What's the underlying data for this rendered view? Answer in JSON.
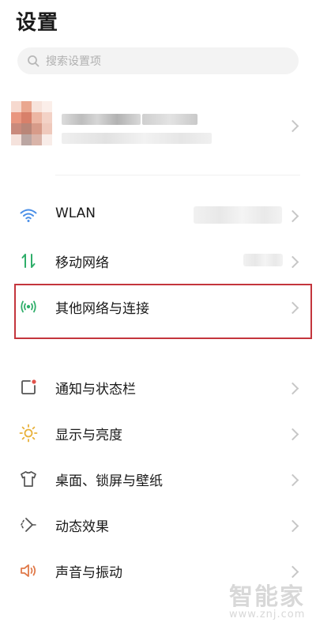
{
  "title": "设置",
  "search": {
    "placeholder": "搜索设置项",
    "icon": "search-icon"
  },
  "colors": {
    "accent_blue": "#4a8fe7",
    "accent_green": "#2fae6a",
    "accent_red": "#e2524b",
    "accent_yellow": "#e8b13a",
    "highlight_border": "#c4353d"
  },
  "sections": {
    "network": [
      {
        "label": "WLAN",
        "icon": "wifi-icon",
        "value_hidden": true
      },
      {
        "label": "移动网络",
        "icon": "mobile-data-icon",
        "value_hidden": true
      },
      {
        "label": "其他网络与连接",
        "icon": "connection-icon",
        "highlighted": true
      }
    ],
    "general": [
      {
        "label": "通知与状态栏",
        "icon": "notification-icon"
      },
      {
        "label": "显示与亮度",
        "icon": "brightness-icon"
      },
      {
        "label": "桌面、锁屏与壁纸",
        "icon": "wallpaper-icon"
      },
      {
        "label": "动态效果",
        "icon": "animation-icon"
      },
      {
        "label": "声音与振动",
        "icon": "sound-icon"
      }
    ]
  },
  "watermark": {
    "main": "智能家",
    "sub": "www.znj.com"
  }
}
